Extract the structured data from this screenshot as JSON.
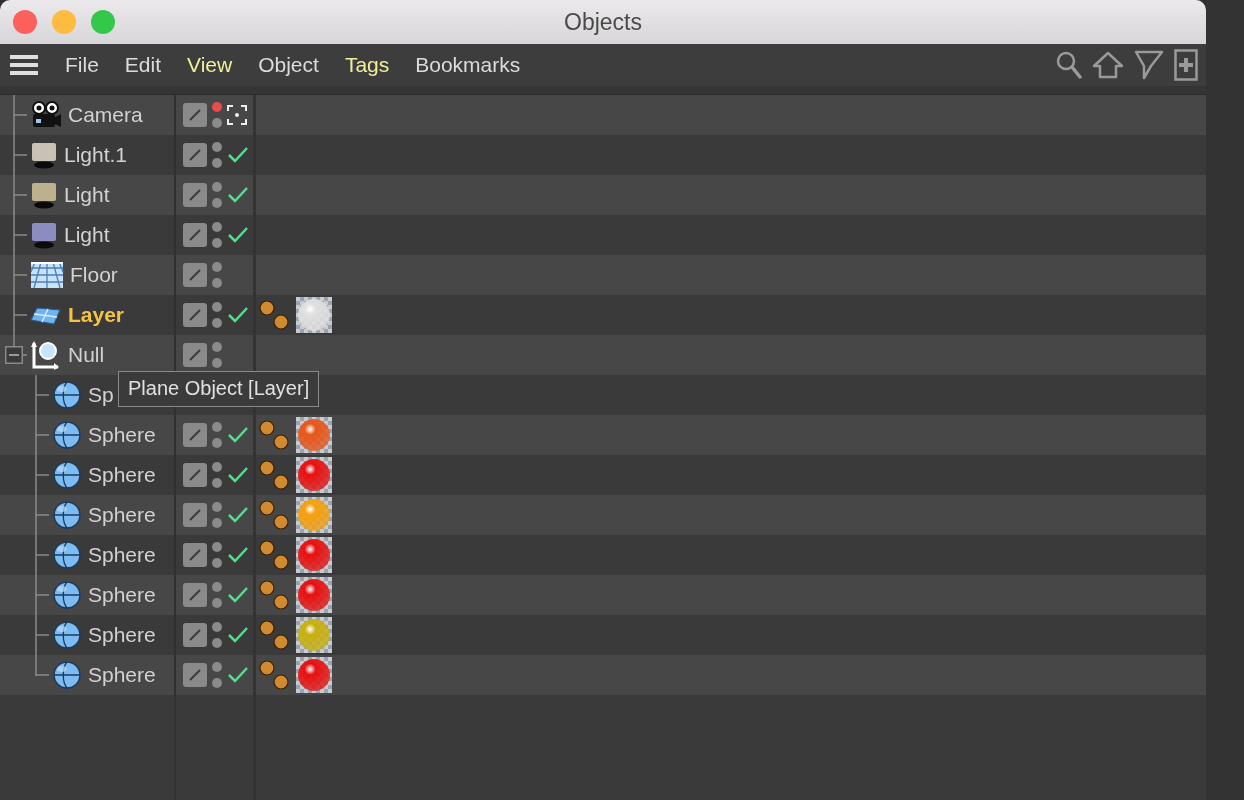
{
  "window": {
    "title": "Objects"
  },
  "menu": [
    {
      "label": "File",
      "highlighted": false
    },
    {
      "label": "Edit",
      "highlighted": false
    },
    {
      "label": "View",
      "highlighted": true
    },
    {
      "label": "Object",
      "highlighted": false
    },
    {
      "label": "Tags",
      "highlighted": true
    },
    {
      "label": "Bookmarks",
      "highlighted": false
    }
  ],
  "objects": [
    {
      "name": "Camera",
      "kind": "camera",
      "selected": false,
      "editor_on": true,
      "checked": false,
      "active_camera": true
    },
    {
      "name": "Light.1",
      "kind": "light",
      "color": "#c8c2b4",
      "selected": false,
      "editor_on": false,
      "checked": true,
      "active_camera": false
    },
    {
      "name": "Light",
      "kind": "light",
      "color": "#bdb08c",
      "selected": false,
      "editor_on": false,
      "checked": true,
      "active_camera": false
    },
    {
      "name": "Light",
      "kind": "light",
      "color": "#8c8cc0",
      "selected": false,
      "editor_on": false,
      "checked": true,
      "active_camera": false
    },
    {
      "name": "Floor",
      "kind": "floor",
      "selected": false,
      "editor_on": false,
      "checked": false,
      "active_camera": false
    },
    {
      "name": "Layer",
      "kind": "plane",
      "selected": true,
      "editor_on": false,
      "checked": true,
      "active_camera": false,
      "tags": [
        {
          "kind": "display"
        },
        {
          "kind": "material",
          "color": "#e0e0e0"
        }
      ]
    },
    {
      "name": "Null",
      "kind": "null",
      "selected": false,
      "editor_on": false,
      "checked": false,
      "active_camera": false,
      "expanded": true,
      "children": [
        {
          "name": "Sp",
          "kind": "sphere",
          "selected": false
        },
        {
          "name": "Sphere",
          "kind": "sphere",
          "selected": false,
          "editor_on": false,
          "checked": true,
          "active_camera": false,
          "tags": [
            {
              "kind": "display"
            },
            {
              "kind": "material",
              "color": "#e8561a"
            }
          ]
        },
        {
          "name": "Sphere",
          "kind": "sphere",
          "selected": false,
          "editor_on": false,
          "checked": true,
          "active_camera": false,
          "tags": [
            {
              "kind": "display"
            },
            {
              "kind": "material",
              "color": "#e81010"
            }
          ]
        },
        {
          "name": "Sphere",
          "kind": "sphere",
          "selected": false,
          "editor_on": false,
          "checked": true,
          "active_camera": false,
          "tags": [
            {
              "kind": "display"
            },
            {
              "kind": "material",
              "color": "#f5a010"
            }
          ]
        },
        {
          "name": "Sphere",
          "kind": "sphere",
          "selected": false,
          "editor_on": false,
          "checked": true,
          "active_camera": false,
          "tags": [
            {
              "kind": "display"
            },
            {
              "kind": "material",
              "color": "#e81010"
            }
          ]
        },
        {
          "name": "Sphere",
          "kind": "sphere",
          "selected": false,
          "editor_on": false,
          "checked": true,
          "active_camera": false,
          "tags": [
            {
              "kind": "display"
            },
            {
              "kind": "material",
              "color": "#e81010"
            }
          ]
        },
        {
          "name": "Sphere",
          "kind": "sphere",
          "selected": false,
          "editor_on": false,
          "checked": true,
          "active_camera": false,
          "tags": [
            {
              "kind": "display"
            },
            {
              "kind": "material",
              "color": "#c8b010"
            }
          ]
        },
        {
          "name": "Sphere",
          "kind": "sphere",
          "selected": false,
          "editor_on": false,
          "checked": true,
          "active_camera": false,
          "tags": [
            {
              "kind": "display"
            },
            {
              "kind": "material",
              "color": "#e81010"
            }
          ]
        }
      ]
    }
  ],
  "tooltip": {
    "text": "Plane Object [Layer]"
  }
}
